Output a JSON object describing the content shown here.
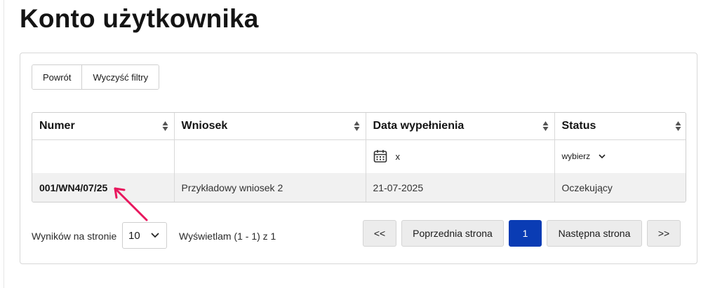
{
  "page": {
    "title": "Konto użytkownika"
  },
  "toolbar": {
    "back_label": "Powrót",
    "clear_filters_label": "Wyczyść filtry"
  },
  "table": {
    "columns": [
      {
        "label": "Numer"
      },
      {
        "label": "Wniosek"
      },
      {
        "label": "Data wypełnienia"
      },
      {
        "label": "Status"
      }
    ],
    "filters": {
      "date_clear": "x",
      "status_placeholder": "wybierz"
    },
    "rows": [
      {
        "numer": "001/WN4/07/25",
        "wniosek": "Przykładowy wniosek 2",
        "data": "21-07-2025",
        "status": "Oczekujący"
      }
    ]
  },
  "footer": {
    "per_page_label": "Wyników na stronie",
    "per_page_value": "10",
    "showing": "Wyświetlam (1 - 1) z 1"
  },
  "pagination": {
    "first": "<<",
    "prev": "Poprzednia strona",
    "current": "1",
    "next": "Następna strona",
    "last": ">>"
  },
  "colors": {
    "accent": "#0a3cb4",
    "annotation_arrow": "#e8175d"
  }
}
